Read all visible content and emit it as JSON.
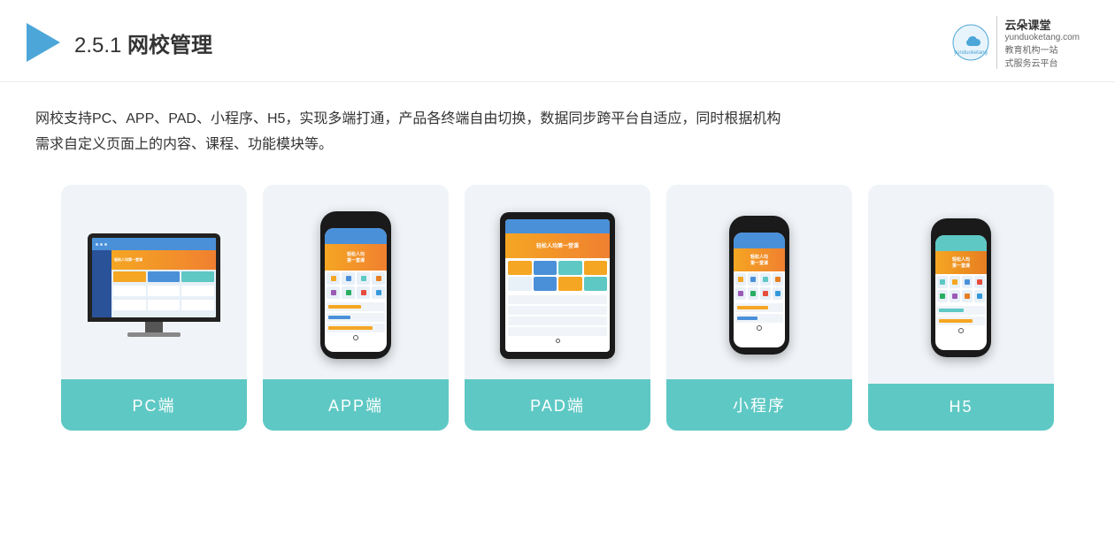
{
  "header": {
    "title_prefix": "2.5.1 ",
    "title_main": "网校管理",
    "brand": {
      "name": "云朵课堂",
      "url": "yunduoketang.com",
      "tagline1": "教育机构一站",
      "tagline2": "式服务云平台"
    }
  },
  "description": {
    "text_line1": "网校支持PC、APP、PAD、小程序、H5，实现多端打通，产品各终端自由切换，数据同步跨平台自适应，同时根据机构",
    "text_line2": "需求自定义页面上的内容、课程、功能模块等。"
  },
  "cards": [
    {
      "id": "pc",
      "label": "PC端",
      "device": "pc"
    },
    {
      "id": "app",
      "label": "APP端",
      "device": "phone"
    },
    {
      "id": "pad",
      "label": "PAD端",
      "device": "tablet"
    },
    {
      "id": "miniapp",
      "label": "小程序",
      "device": "phone-small"
    },
    {
      "id": "h5",
      "label": "H5",
      "device": "phone-small2"
    }
  ],
  "accent_color": "#5ec8c4"
}
